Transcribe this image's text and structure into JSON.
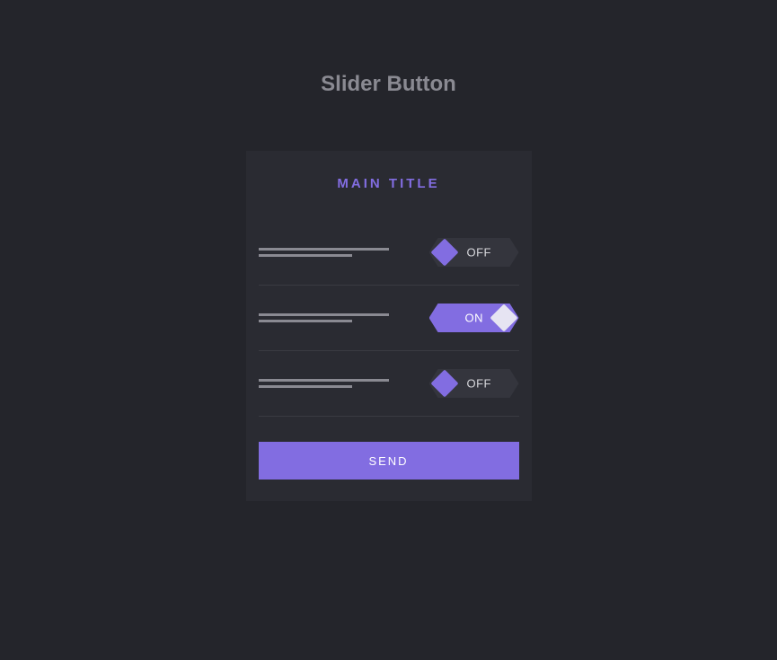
{
  "page_title": "Slider Button",
  "card": {
    "title": "MAIN TITLE",
    "toggles": [
      {
        "state": "off",
        "label": "OFF"
      },
      {
        "state": "on",
        "label": "ON"
      },
      {
        "state": "off",
        "label": "OFF"
      }
    ],
    "send_label": "SEND"
  },
  "colors": {
    "accent": "#826de1",
    "bg": "#24252b",
    "card_bg": "#2a2b32"
  }
}
